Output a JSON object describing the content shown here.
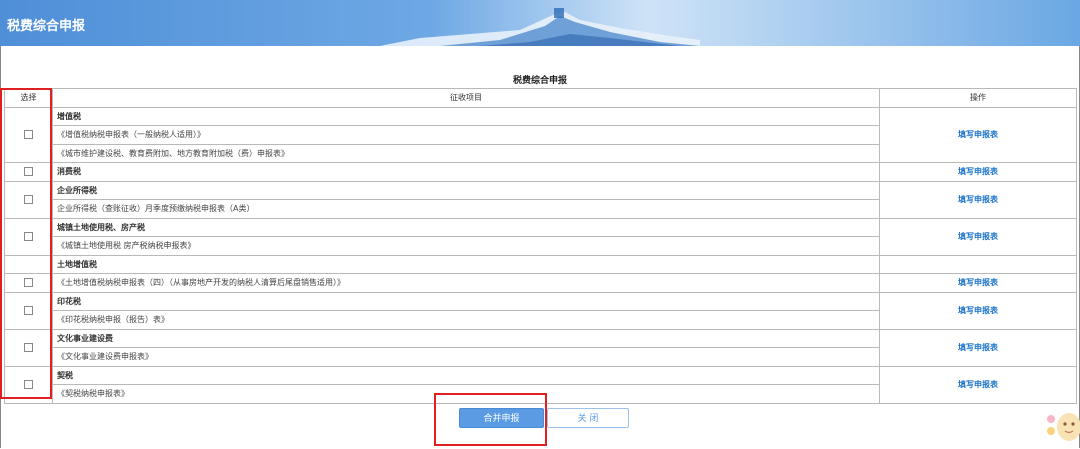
{
  "header": {
    "title": "税费综合申报"
  },
  "main": {
    "title": "税费综合申报"
  },
  "table": {
    "col_select": "选择",
    "col_item": "征收项目",
    "col_op": "操作",
    "fill_label": "填写申报表",
    "groups": [
      {
        "category": "增值税",
        "forms": [
          "《增值税纳税申报表（一般纳税人适用）》",
          "《城市维护建设税、教育费附加、地方教育附加税（费）申报表》"
        ]
      },
      {
        "category": "消费税",
        "forms": []
      },
      {
        "category": "企业所得税",
        "forms": [
          "企业所得税（查账征收）月季度预缴纳税申报表（A类）"
        ]
      },
      {
        "category": "城镇土地使用税、房产税",
        "forms": [
          "《城镇土地使用税 房产税纳税申报表》"
        ]
      },
      {
        "category": "土地增值税",
        "forms": [
          "《土地增值税纳税申报表（四）（从事房地产开发的纳税人清算后尾盘销售适用）》"
        ]
      },
      {
        "category": "印花税",
        "forms": [
          "《印花税纳税申报（报告）表》"
        ]
      },
      {
        "category": "文化事业建设费",
        "forms": [
          "《文化事业建设费申报表》"
        ]
      },
      {
        "category": "契税",
        "forms": [
          "《契税纳税申报表》"
        ]
      }
    ]
  },
  "buttons": {
    "submit": "合并申报",
    "close": "关 闭"
  },
  "colors": {
    "accent": "#5a9be4",
    "link": "#1a73c8",
    "highlight": "#e02020"
  }
}
